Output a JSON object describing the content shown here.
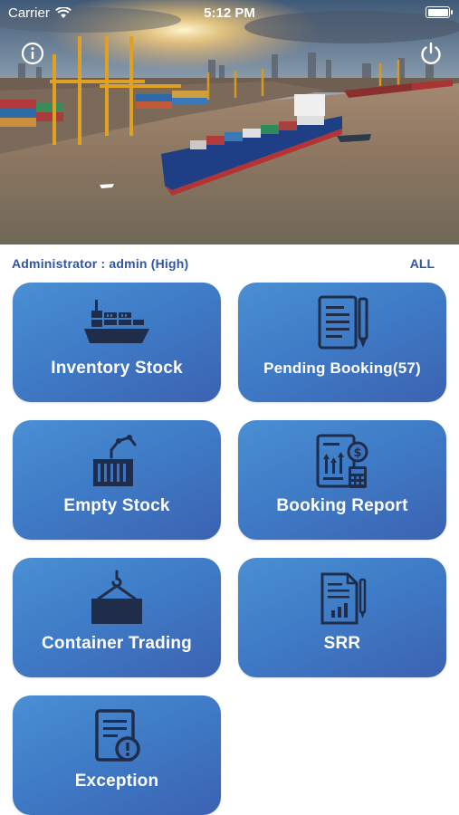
{
  "status_bar": {
    "carrier": "Carrier",
    "time": "5:12 PM"
  },
  "header": {
    "info_icon": "info-icon",
    "power_icon": "power-icon"
  },
  "user": {
    "label": "Administrator : admin (High)",
    "filter": "ALL"
  },
  "tiles": [
    {
      "label": "Inventory Stock",
      "icon": "ship-icon"
    },
    {
      "label": "Pending Booking(57)",
      "icon": "document-pen-icon"
    },
    {
      "label": "Empty Stock",
      "icon": "crane-container-icon"
    },
    {
      "label": "Booking Report",
      "icon": "report-icon"
    },
    {
      "label": "Container Trading",
      "icon": "hook-container-icon"
    },
    {
      "label": "SRR",
      "icon": "chart-document-icon"
    },
    {
      "label": "Exception",
      "icon": "document-warning-icon"
    }
  ],
  "colors": {
    "tile_gradient_start": "#4a8fd3",
    "tile_gradient_end": "#3b62b2",
    "accent_text": "#2f55a4",
    "icon_dark": "#1f2d4a"
  }
}
